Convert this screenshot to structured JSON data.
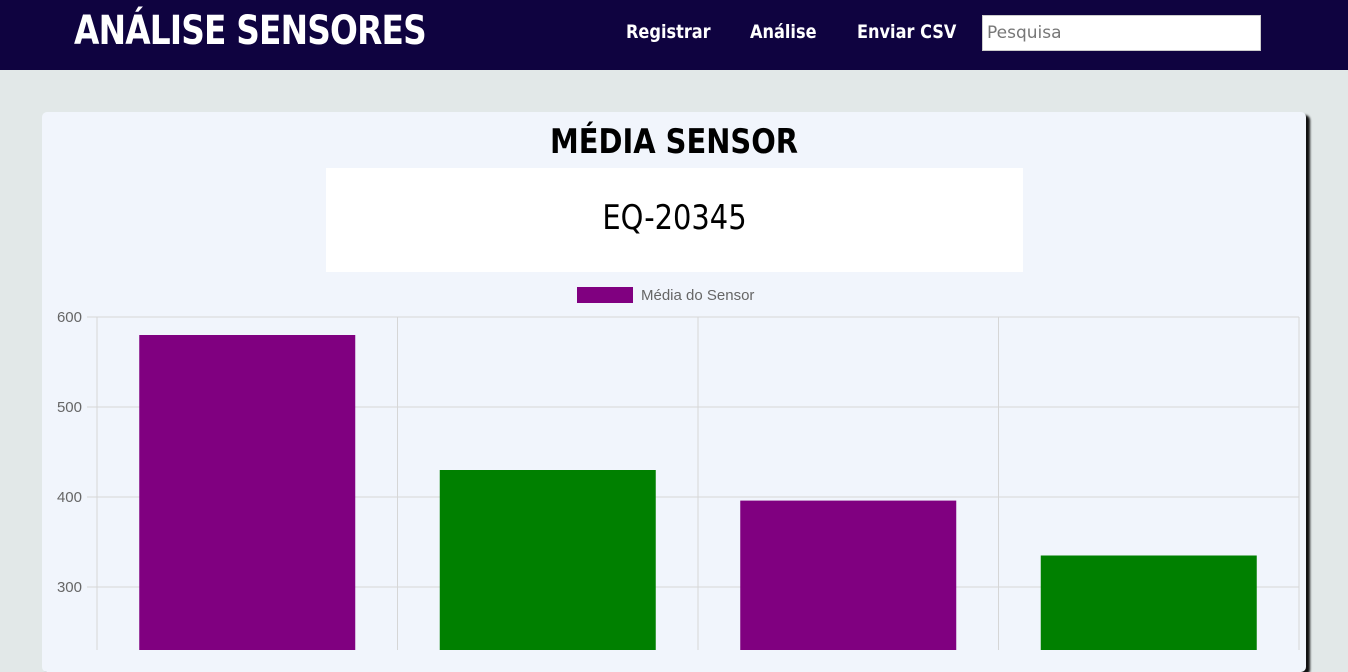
{
  "header": {
    "brand": "ANÁLISE SENSORES",
    "nav": [
      {
        "label": "Registrar"
      },
      {
        "label": "Análise"
      },
      {
        "label": "Enviar CSV"
      }
    ],
    "search": {
      "placeholder": "Pesquisa",
      "value": ""
    }
  },
  "card": {
    "title": "MÉDIA SENSOR",
    "sensor_id": "EQ-20345"
  },
  "colors": {
    "header_bg": "#0f0340",
    "series_purple": "#800080",
    "series_green": "#008000"
  },
  "chart_data": {
    "type": "bar",
    "categories": [
      "",
      "",
      "",
      ""
    ],
    "series": [
      {
        "name": "Média do Sensor",
        "values": [
          580,
          430,
          396,
          335
        ]
      }
    ],
    "bar_colors": [
      "#800080",
      "#008000",
      "#800080",
      "#008000"
    ],
    "y_ticks": [
      600,
      500,
      400,
      300
    ],
    "ylim": [
      300,
      600
    ],
    "legend_position": "top-center",
    "grid": true
  }
}
